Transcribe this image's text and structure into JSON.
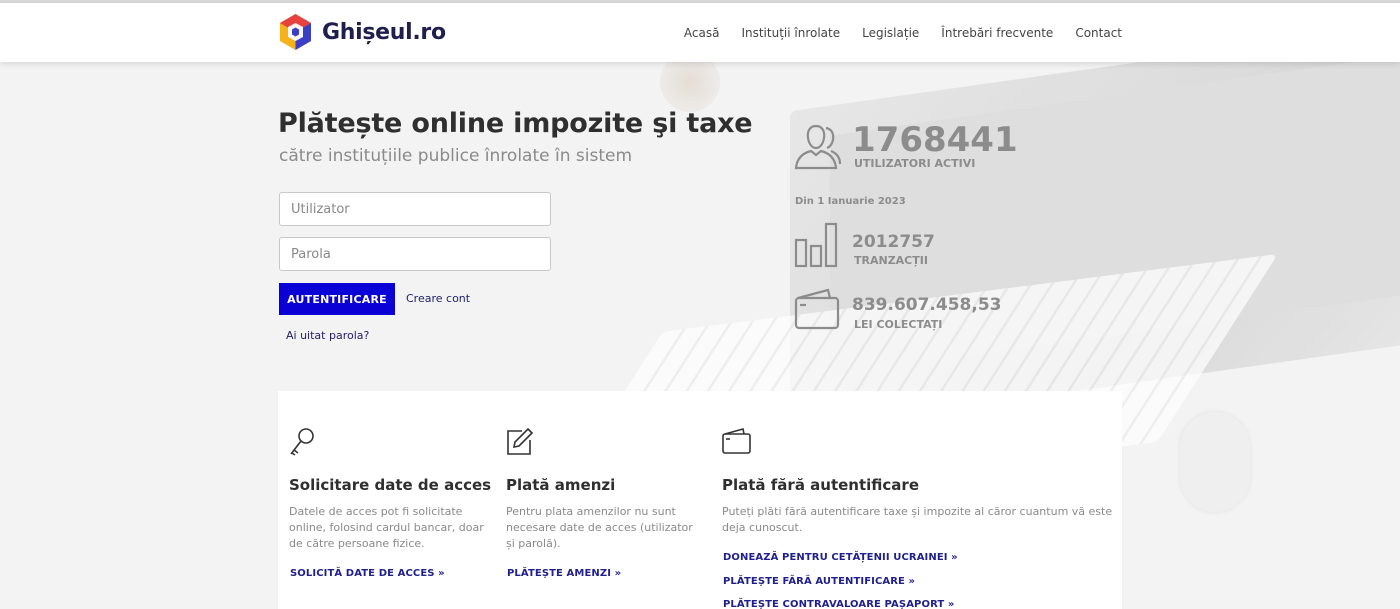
{
  "header": {
    "logo_text": "Ghișeul.ro",
    "nav": [
      {
        "label": "Acasă"
      },
      {
        "label": "Instituții înrolate"
      },
      {
        "label": "Legislație"
      },
      {
        "label": "Întrebări frecvente"
      },
      {
        "label": "Contact"
      }
    ]
  },
  "hero": {
    "title": "Plătește online impozite şi taxe",
    "subtitle": "către instituțiile publice înrolate în sistem",
    "login": {
      "username_placeholder": "Utilizator",
      "password_placeholder": "Parola",
      "submit_label": "AUTENTIFICARE",
      "create_account": "Creare cont",
      "forgot_password": "Ai uitat parola?"
    }
  },
  "stats": {
    "users": {
      "value": "1768441",
      "label": "UTILIZATORI ACTIVI",
      "icon": "users-icon"
    },
    "since": "Din 1 Ianuarie 2023",
    "transactions": {
      "value": "2012757",
      "label": "TRANZACȚII",
      "icon": "bar-chart-icon"
    },
    "collected": {
      "value": "839.607.458,53",
      "label": "LEI COLECTAȚI",
      "icon": "wallet-icon"
    }
  },
  "cards": [
    {
      "icon": "key-icon",
      "title": "Solicitare date de acces",
      "text": "Datele de acces pot fi solicitate online, folosind cardul bancar, doar de către persoane fizice.",
      "links": [
        "SOLICITĂ DATE DE ACCES »"
      ]
    },
    {
      "icon": "edit-icon",
      "title": "Plată amenzi",
      "text": "Pentru plata amenzilor nu sunt necesare date de acces (utilizator și parolă).",
      "links": [
        "PLĂTEȘTE AMENZI »"
      ]
    },
    {
      "icon": "wallet-icon",
      "title": "Plată fără autentificare",
      "text": "Puteți plăti fără autentificare taxe și impozite al căror cuantum vă este deja cunoscut.",
      "links": [
        "DONEAZĂ PENTRU CETĂȚENII UCRAINEI »",
        "PLĂTEȘTE FĂRĂ AUTENTIFICARE »",
        "PLĂTEȘTE CONTRAVALOARE PAȘAPORT »"
      ]
    }
  ],
  "colors": {
    "primary_button": "#0a00d6",
    "link": "#1f1f6e",
    "stat_gray": "#8c8c8c"
  }
}
